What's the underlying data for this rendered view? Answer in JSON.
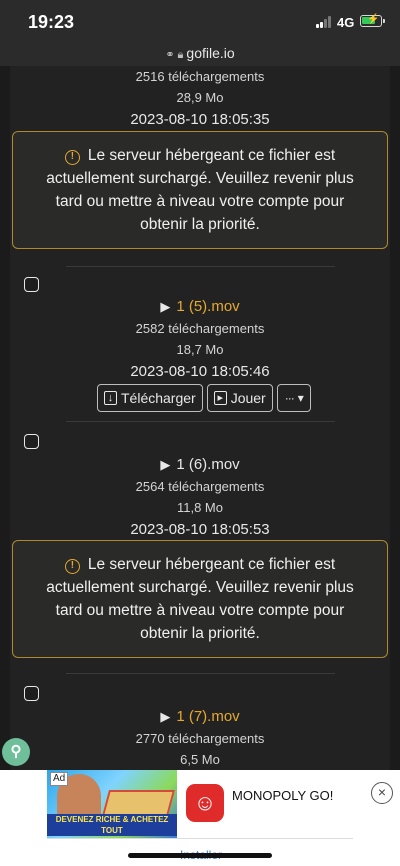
{
  "status_bar": {
    "time": "19:23",
    "network": "4G"
  },
  "browser": {
    "url": "gofile.io"
  },
  "files": [
    {
      "name": "",
      "downloads": "2516 téléchargements",
      "size": "28,9 Mo",
      "date": "2023-08-10 18:05:35"
    },
    {
      "name": "1 (5).mov",
      "downloads": "2582 téléchargements",
      "size": "18,7 Mo",
      "date": "2023-08-10 18:05:46"
    },
    {
      "name": "1 (6).mov",
      "downloads": "2564 téléchargements",
      "size": "11,8 Mo",
      "date": "2023-08-10 18:05:53"
    },
    {
      "name": "1 (7).mov",
      "downloads": "2770 téléchargements",
      "size": "6,5 Mo",
      "date": ""
    }
  ],
  "warning": {
    "text": "Le serveur hébergeant ce fichier est actuellement surchargé. Veuillez revenir plus tard ou mettre à niveau votre compte pour obtenir la priorité."
  },
  "actions": {
    "download": "Télécharger",
    "play": "Jouer",
    "more": "···"
  },
  "ad": {
    "label": "Ad",
    "banner_text": "DEVENEZ RICHE & ACHETEZ TOUT",
    "app_name": "MONOPOLY GO!",
    "install": "Installer"
  },
  "colors": {
    "accent": "#e5a830",
    "background": "#1b1b1b",
    "panel": "#222222"
  }
}
